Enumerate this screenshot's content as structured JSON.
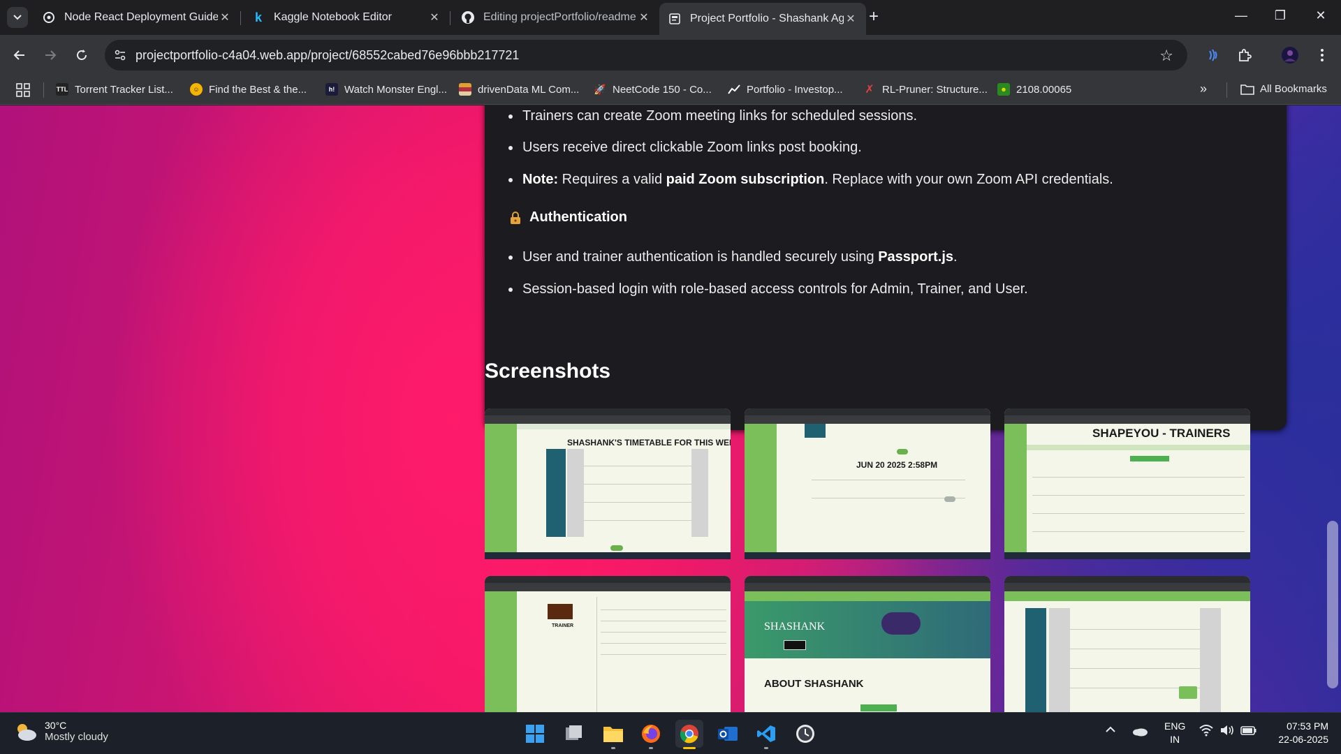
{
  "browser": {
    "tabs": [
      {
        "title": "Node React Deployment Guide",
        "icon": "openai-icon"
      },
      {
        "title": "Kaggle Notebook Editor",
        "icon": "kaggle-icon"
      },
      {
        "title": "Editing projectPortfolio/readme",
        "icon": "github-icon"
      },
      {
        "title": "Project Portfolio - Shashank Ag",
        "icon": "page-icon",
        "active": true
      }
    ],
    "url": "projectportfolio-c4a04.web.app/project/68552cabed76e96bbb217721",
    "bookmarks": [
      {
        "label": "Torrent Tracker List...",
        "icon": "ttl-icon",
        "color": "#222222"
      },
      {
        "label": "Find the Best & the...",
        "icon": "smiley-icon",
        "color": "#f5b400"
      },
      {
        "label": "Watch Monster Engl...",
        "icon": "hi-icon",
        "color": "#1b1b3a"
      },
      {
        "label": "drivenData ML Com...",
        "icon": "drivendata-icon",
        "color": "#e0a030"
      },
      {
        "label": "NeetCode 150 - Co...",
        "icon": "rocket-icon",
        "color": "#ff7a00"
      },
      {
        "label": "Portfolio - Investop...",
        "icon": "chart-icon",
        "color": "#ffffff"
      },
      {
        "label": "RL-Pruner: Structure...",
        "icon": "arxiv-icon",
        "color": "#b31b1b"
      },
      {
        "label": "2108.00065",
        "icon": "face-icon",
        "color": "#f0e000"
      }
    ],
    "all_bookmarks": "All Bookmarks"
  },
  "content": {
    "zoom_bullets": [
      "Trainers can create Zoom meeting links for scheduled sessions.",
      "Users receive direct clickable Zoom links post booking."
    ],
    "note": {
      "label": "Note:",
      "pre": " Requires a valid ",
      "bold": "paid Zoom subscription",
      "post": ". Replace with your own Zoom API credentials."
    },
    "auth_heading": "Authentication",
    "auth_bullet1": {
      "pre": "User and trainer authentication is handled securely using ",
      "bold": "Passport.js",
      "post": "."
    },
    "auth_bullet2": "Session-based login with role-based access controls for Admin, Trainer, and User.",
    "screenshots_title": "Screenshots",
    "shots": [
      {
        "title": "SHASHANK'S TIMETABLE FOR THIS WEEK."
      },
      {
        "title": "JUN 20 2025 2:58PM"
      },
      {
        "title": "SHAPEYOU - TRAINERS"
      },
      {
        "title": "TRAINER"
      },
      {
        "title": "ABOUT SHASHANK",
        "name": "SHASHANK"
      },
      {
        "title": ""
      }
    ]
  },
  "taskbar": {
    "weather_temp": "30°C",
    "weather_cond": "Mostly cloudy",
    "lang_line1": "ENG",
    "lang_line2": "IN",
    "time": "07:53 PM",
    "date": "22-06-2025"
  }
}
